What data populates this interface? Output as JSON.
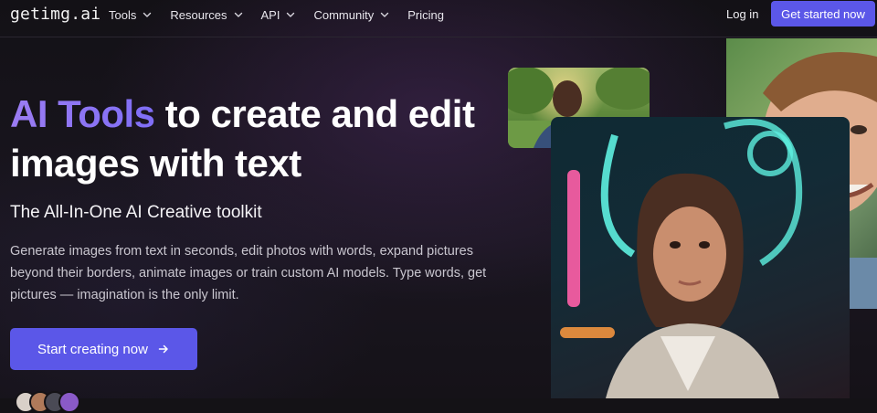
{
  "nav": {
    "logo": "getimg.ai",
    "items": [
      {
        "label": "Tools",
        "has_dropdown": true
      },
      {
        "label": "Resources",
        "has_dropdown": true
      },
      {
        "label": "API",
        "has_dropdown": true
      },
      {
        "label": "Community",
        "has_dropdown": true
      },
      {
        "label": "Pricing",
        "has_dropdown": false
      }
    ],
    "login_label": "Log in",
    "cta_label": "Get started now"
  },
  "hero": {
    "headline_accent": "AI Tools",
    "headline_rest": " to create and edit images with text",
    "subtitle": "The All-In-One AI Creative toolkit",
    "description": "Generate images from text in seconds, edit photos with words, expand pictures beyond their borders, animate images or train custom AI models. Type words, get pictures — imagination is the only limit.",
    "cta_label": "Start creating now",
    "cta_icon": "arrow-right-icon"
  },
  "colors": {
    "accent": "#5b57e8",
    "gradient_text": "#8f74f4",
    "background": "#141216"
  },
  "icons": {
    "dropdown": "chevron-down-icon"
  }
}
